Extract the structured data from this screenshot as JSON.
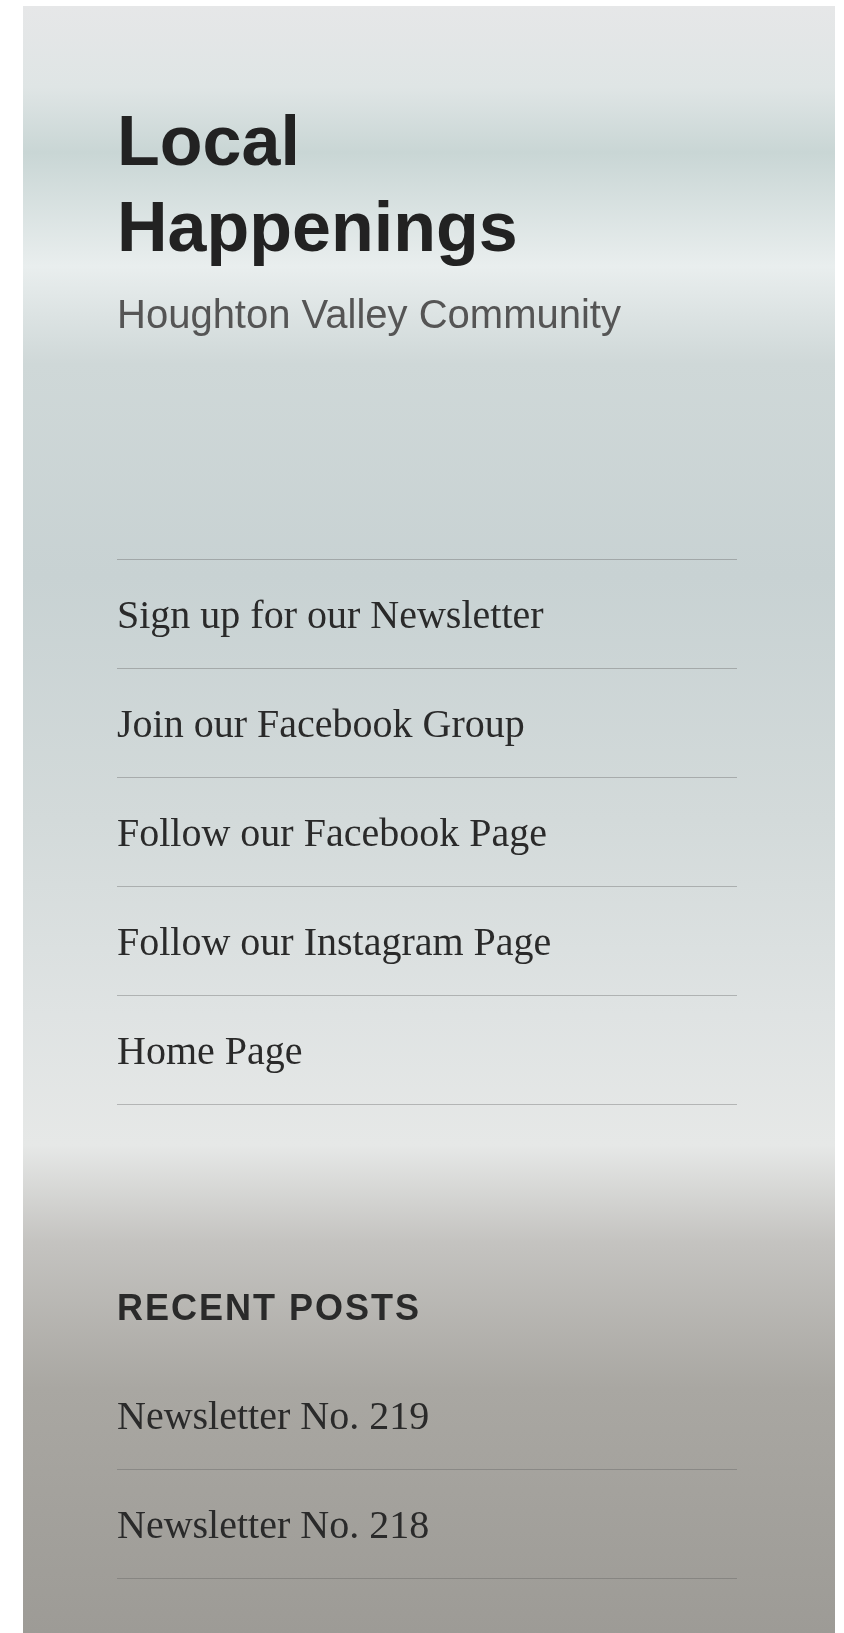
{
  "site": {
    "title": "Local Happenings",
    "tagline": "Houghton Valley Community"
  },
  "menu": [
    {
      "label": "Sign up for our Newsletter"
    },
    {
      "label": "Join our Facebook Group"
    },
    {
      "label": "Follow our Facebook Page"
    },
    {
      "label": "Follow our Instagram Page"
    },
    {
      "label": "Home Page"
    }
  ],
  "recent_posts": {
    "heading": "RECENT POSTS",
    "items": [
      {
        "label": "Newsletter No. 219"
      },
      {
        "label": "Newsletter No. 218"
      }
    ]
  }
}
